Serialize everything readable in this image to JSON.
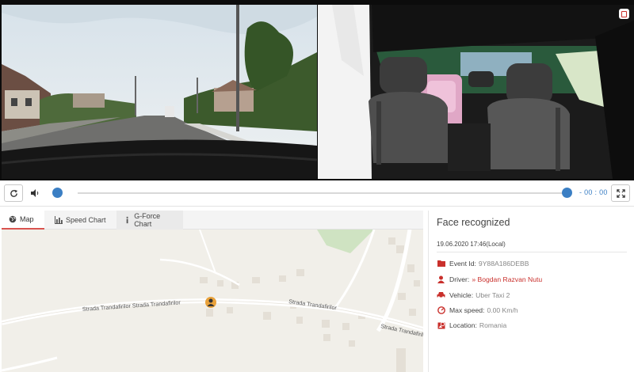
{
  "player": {
    "time": "- 00 : 00",
    "icons": {
      "reload": "reload-icon",
      "volume": "volume-icon",
      "fullscreen": "fullscreen-icon",
      "download": "download-icon"
    },
    "accent_color": "#3b7fc4"
  },
  "tabs": [
    {
      "label": "Map",
      "icon": "globe-icon",
      "active": true
    },
    {
      "label": "Speed Chart",
      "icon": "bar-chart-icon",
      "active": false
    },
    {
      "label": "G-Force Chart",
      "icon": "info-icon",
      "active": false
    }
  ],
  "map": {
    "street_labels": [
      "Strada Trandafirilor Strada Trandafirilor",
      "Strada Trandafirilor",
      "Strada Trandafirilor"
    ],
    "marker_icon": "driver-pin-icon"
  },
  "event": {
    "title": "Face recognized",
    "datetime": "19.06.2020 17:46(Local)",
    "id_label": "Event Id:",
    "id_value": "9Y88A186DEBB",
    "driver_label": "Driver:",
    "driver_value": "» Bogdan Razvan Nutu",
    "vehicle_label": "Vehicle:",
    "vehicle_value": "Uber Taxi 2",
    "speed_label": "Max speed:",
    "speed_value": "0.00 Km/h",
    "location_label": "Location:",
    "location_value": "Romania",
    "accent_color": "#c9302c"
  }
}
